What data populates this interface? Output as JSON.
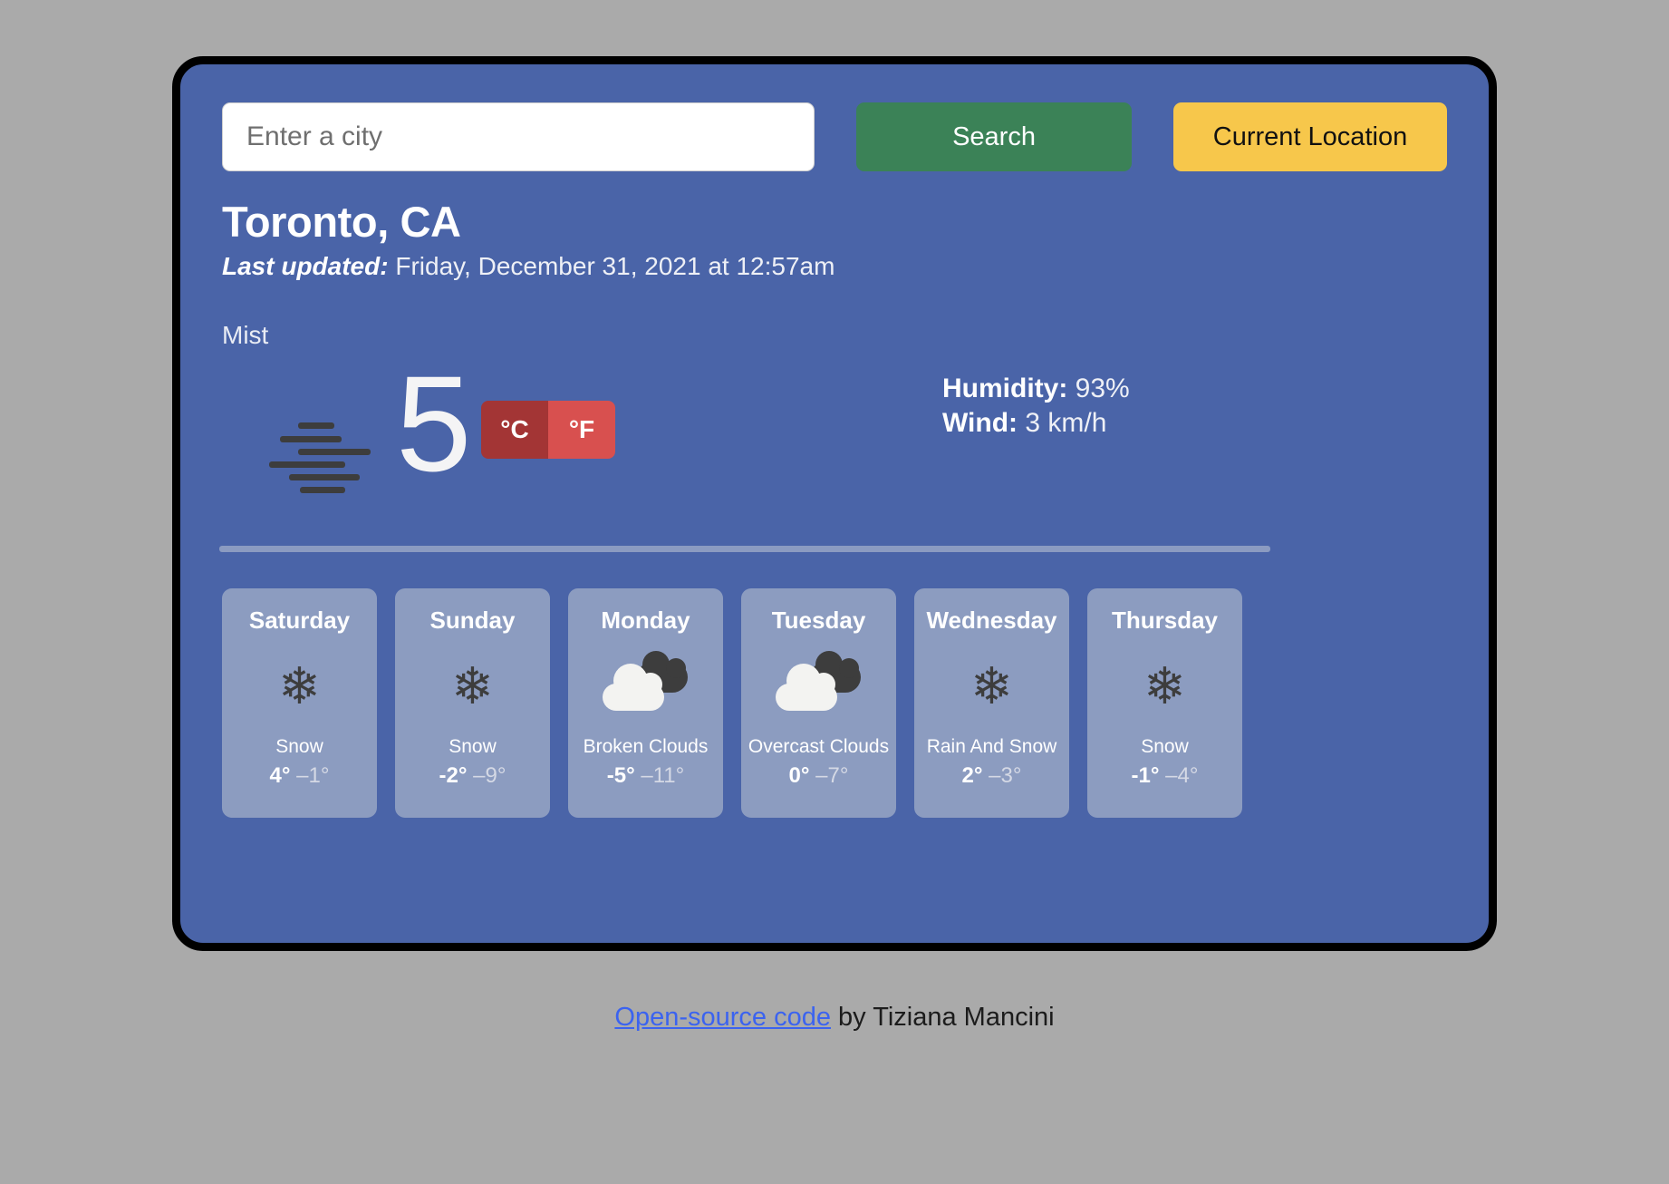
{
  "search": {
    "placeholder": "Enter a city",
    "value": "",
    "search_label": "Search",
    "current_location_label": "Current Location"
  },
  "current": {
    "city": "Toronto, CA",
    "updated_label": "Last updated:",
    "updated_value": " Friday, December 31, 2021 at 12:57am",
    "condition": "Mist",
    "icon": "mist-icon",
    "temperature": "5",
    "unit_celsius": "°C",
    "unit_fahrenheit": "°F",
    "active_unit": "celsius",
    "humidity_label": "Humidity:",
    "humidity_value": " 93%",
    "wind_label": "Wind:",
    "wind_value": " 3 km/h"
  },
  "forecast": [
    {
      "day": "Saturday",
      "icon": "snowflake-icon",
      "description": "Snow",
      "max": "4°",
      "min": "–1°"
    },
    {
      "day": "Sunday",
      "icon": "snowflake-icon",
      "description": "Snow",
      "max": "-2°",
      "min": "–9°"
    },
    {
      "day": "Monday",
      "icon": "cloud-icon",
      "description": "Broken Clouds",
      "max": "-5°",
      "min": "–11°"
    },
    {
      "day": "Tuesday",
      "icon": "cloud-icon",
      "description": "Overcast Clouds",
      "max": "0°",
      "min": "–7°"
    },
    {
      "day": "Wednesday",
      "icon": "snowflake-icon",
      "description": "Rain And Snow",
      "max": "2°",
      "min": "–3°"
    },
    {
      "day": "Thursday",
      "icon": "snowflake-icon",
      "description": "Snow",
      "max": "-1°",
      "min": "–4°"
    }
  ],
  "footer": {
    "link_text": "Open-source code",
    "byline": " by Tiziana Mancini"
  },
  "colors": {
    "page_background": "#aaaaaa",
    "card_background": "#4a64a8",
    "forecast_card_background": "#8c9cc0",
    "search_button": "#3b8257",
    "location_button": "#f7c74b",
    "unit_active": "#a33535",
    "unit_inactive": "#d8504f",
    "link": "#3b63f0"
  }
}
